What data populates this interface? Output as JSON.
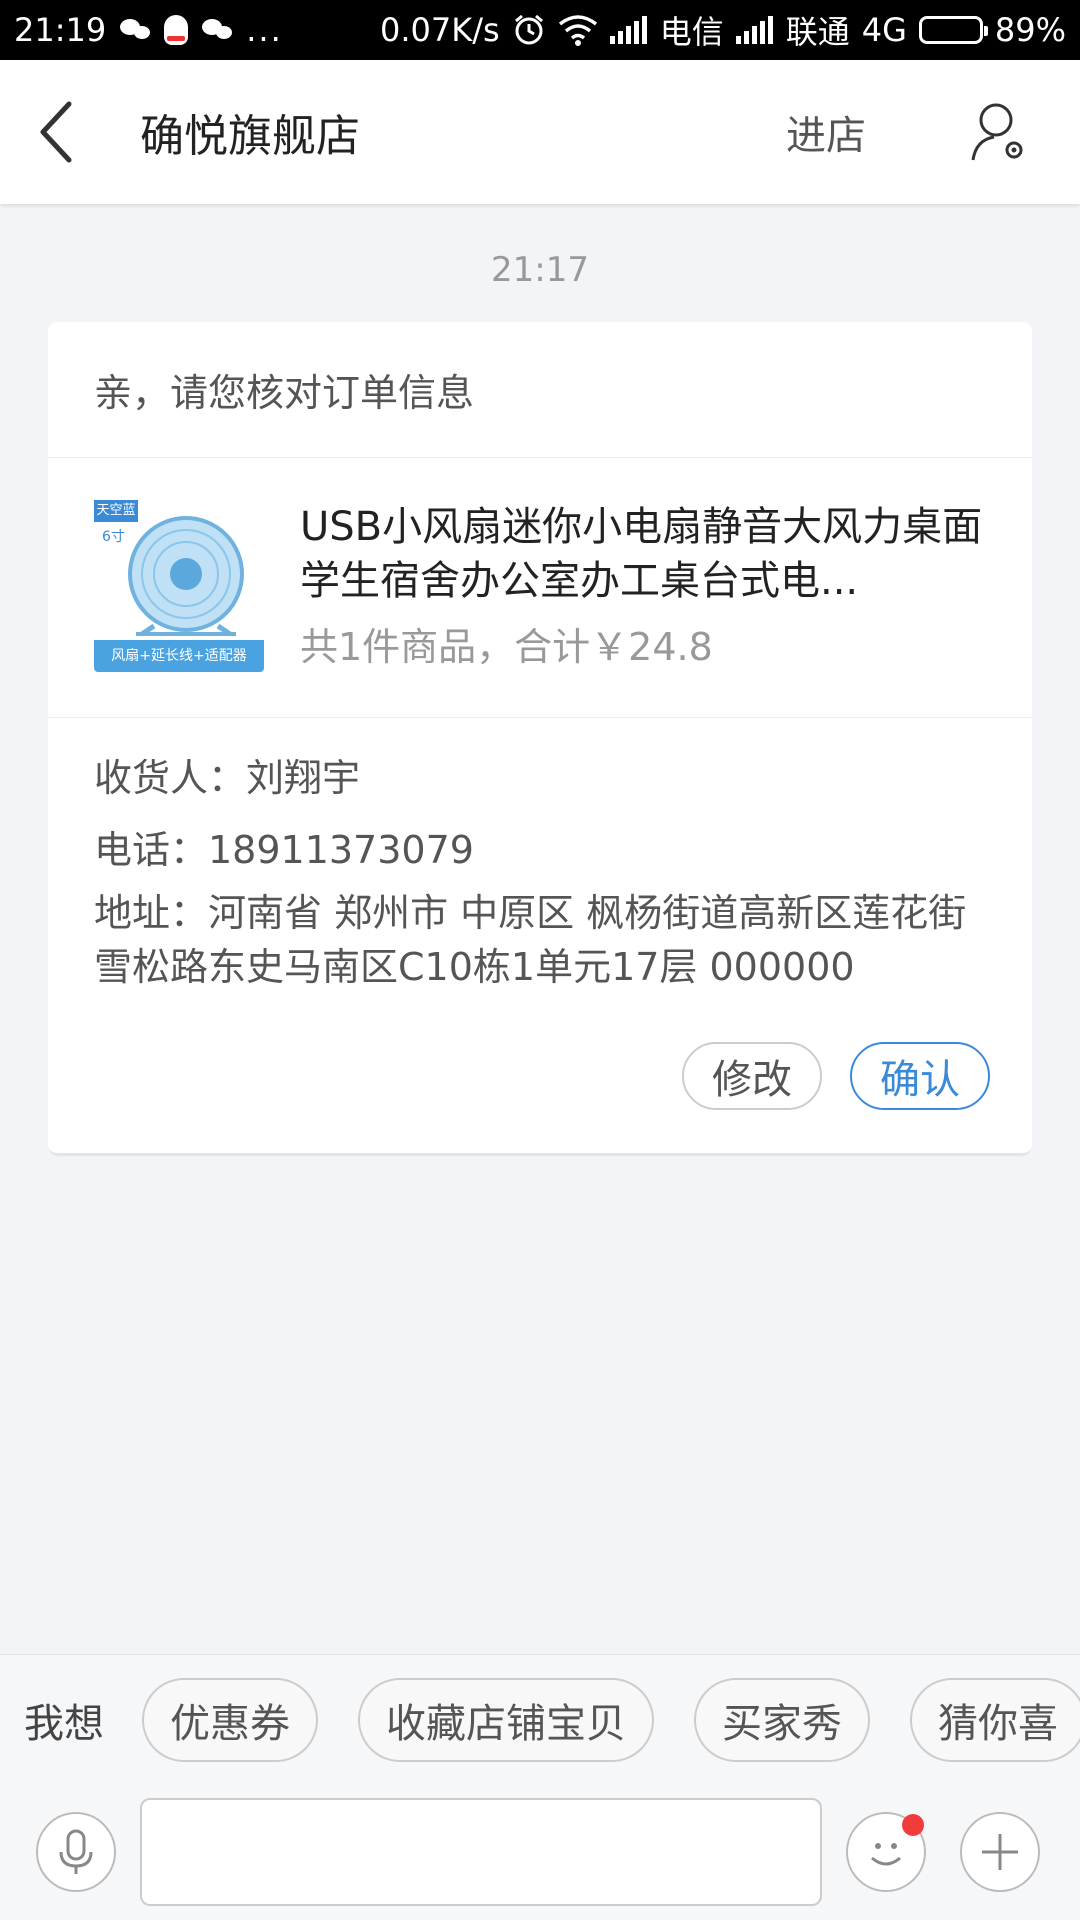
{
  "status_bar": {
    "time": "21:19",
    "dots": "...",
    "net_speed": "0.07K/s",
    "carrier1": "电信",
    "carrier2": "联通",
    "network": "4G",
    "battery": "89%",
    "battery_level": 0.89
  },
  "nav": {
    "title": "确悦旗舰店",
    "enter_store": "进店"
  },
  "chat": {
    "timestamp": "21:17"
  },
  "order_card": {
    "header": "亲，请您核对订单信息",
    "product": {
      "thumb_tag": "天空蓝",
      "thumb_size": "6寸",
      "thumb_banner": "风扇+延长线+适配器",
      "name": "USB小风扇迷你小电扇静音大风力桌面学生宿舍办公室办工桌台式电...",
      "summary": "共1件商品，合计￥24.8"
    },
    "receiver": "收货人：刘翔宇",
    "phone": "电话：18911373079",
    "address": "地址：河南省 郑州市 中原区 枫杨街道高新区莲花街雪松路东史马南区C10栋1单元17层 000000",
    "btn_modify": "修改",
    "btn_confirm": "确认"
  },
  "quick_bar": {
    "label": "我想",
    "chips": [
      "优惠券",
      "收藏店铺宝贝",
      "买家秀",
      "猜你喜"
    ]
  },
  "input_bar": {
    "value": "",
    "placeholder": "",
    "icons": [
      "microphone-icon",
      "emoji-icon",
      "plus-icon"
    ]
  },
  "colors": {
    "accent": "#3a8ad8",
    "notification_dot": "#f23b3b"
  }
}
